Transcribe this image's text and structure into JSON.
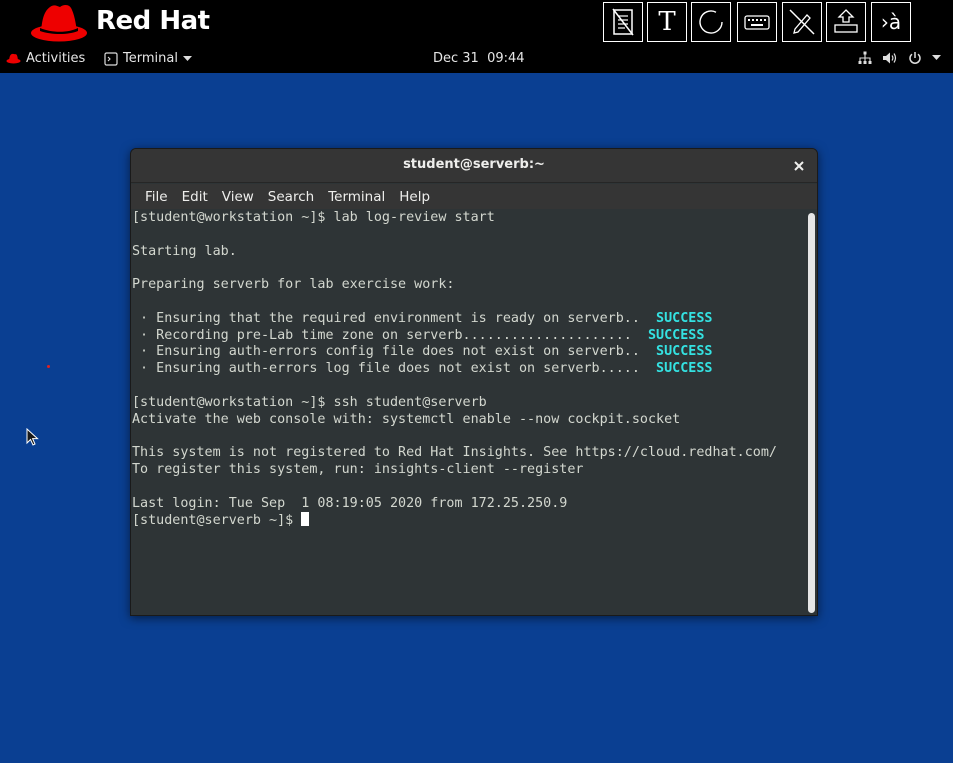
{
  "brand": {
    "wordmark": "Red Hat",
    "brand_color": "#ee0000"
  },
  "toolbar": {
    "tools": [
      {
        "icon": "document-icon"
      },
      {
        "icon": "text-tool-icon",
        "label": "T"
      },
      {
        "icon": "circle-icon"
      },
      {
        "icon": "keyboard-icon"
      },
      {
        "icon": "pen-disabled-icon"
      },
      {
        "icon": "eject-icon"
      },
      {
        "icon": "input-method-icon",
        "label": "›à"
      }
    ]
  },
  "topbar": {
    "activities_label": "Activities",
    "app_menu_label": "Terminal",
    "clock": "Dec 31  09:44",
    "tray_icons": [
      "network-icon",
      "volume-icon",
      "power-icon",
      "chevron-down-icon"
    ]
  },
  "desktop": {
    "background": "#0a3f92"
  },
  "terminal": {
    "title": "student@serverb:~",
    "menu": [
      "File",
      "Edit",
      "View",
      "Search",
      "Terminal",
      "Help"
    ],
    "lines": [
      "[student@workstation ~]$ lab log-review start",
      "",
      "Starting lab.",
      "",
      "Preparing serverb for lab exercise work:",
      ""
    ],
    "status_lines": [
      {
        "text": " · Ensuring that the required environment is ready on serverb..  ",
        "status": "SUCCESS"
      },
      {
        "text": " · Recording pre-Lab time zone on serverb.....................  ",
        "status": "SUCCESS"
      },
      {
        "text": " · Ensuring auth-errors config file does not exist on serverb..  ",
        "status": "SUCCESS"
      },
      {
        "text": " · Ensuring auth-errors log file does not exist on serverb.....  ",
        "status": "SUCCESS"
      }
    ],
    "lines_after": [
      "",
      "[student@workstation ~]$ ssh student@serverb",
      "Activate the web console with: systemctl enable --now cockpit.socket",
      "",
      "This system is not registered to Red Hat Insights. See https://cloud.redhat.com/",
      "To register this system, run: insights-client --register",
      "",
      "Last login: Tue Sep  1 08:19:05 2020 from 172.25.250.9"
    ],
    "prompt": "[student@serverb ~]$ ",
    "success_color": "#34e2e2"
  }
}
